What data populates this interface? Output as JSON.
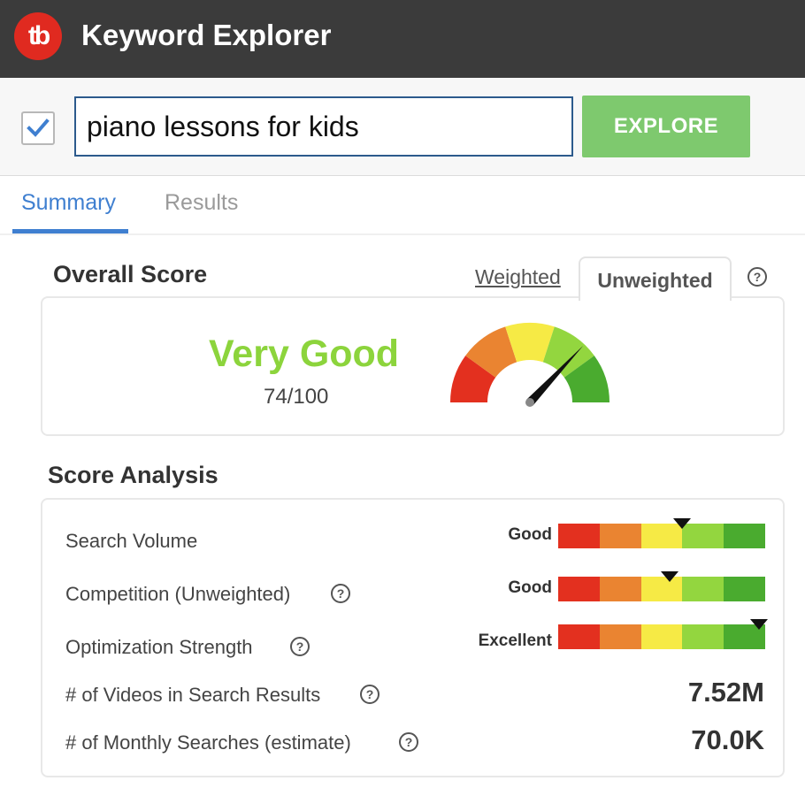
{
  "app": {
    "title": "Keyword Explorer",
    "logo_text": "tb"
  },
  "search": {
    "query": "piano lessons for kids",
    "checked": true,
    "explore_label": "EXPLORE"
  },
  "tabs": [
    {
      "label": "Summary",
      "active": true
    },
    {
      "label": "Results",
      "active": false
    }
  ],
  "overall": {
    "title": "Overall Score",
    "weighted_label": "Weighted",
    "unweighted_label": "Unweighted",
    "help": "?",
    "rating": "Very Good",
    "score": "74/100",
    "score_fraction": 0.74
  },
  "analysis": {
    "title": "Score Analysis",
    "help": "?",
    "rows": [
      {
        "label": "Search Volume",
        "rating": "Good",
        "level": 0.6
      },
      {
        "label": "Competition (Unweighted)",
        "rating": "Good",
        "level": 0.54
      },
      {
        "label": "Optimization Strength",
        "rating": "Excellent",
        "level": 0.97
      }
    ],
    "stats": [
      {
        "label": "# of Videos in Search Results",
        "value": "7.52M"
      },
      {
        "label": "# of Monthly Searches (estimate)",
        "value": "70.0K"
      }
    ]
  },
  "colors": {
    "scale": [
      "#e3301f",
      "#ea8431",
      "#f6ea45",
      "#93d63f",
      "#4aab2f"
    ],
    "accent": "#3f7fd0",
    "explore": "#7ec96e",
    "rating_text": "#8cd43c"
  }
}
